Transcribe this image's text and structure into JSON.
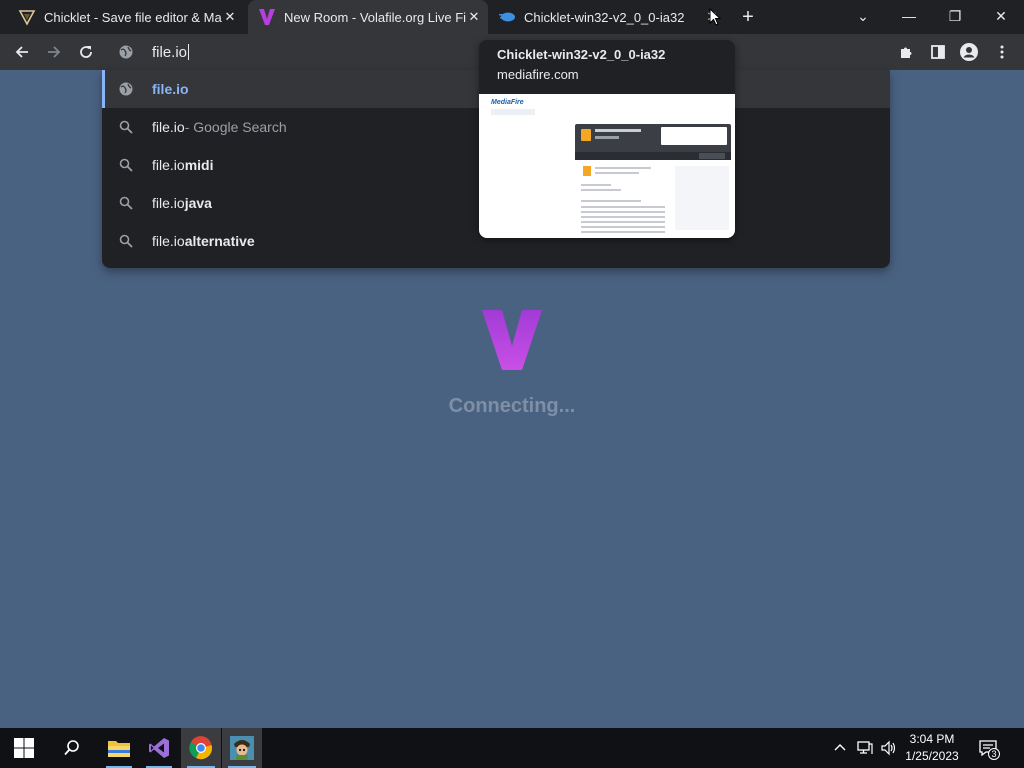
{
  "tabs": [
    {
      "title": "Chicklet - Save file editor & Map",
      "icon": "chicklet-icon",
      "close": "✕"
    },
    {
      "title": "New Room - Volafile.org Live File",
      "icon": "volafile-v-icon",
      "close": "✕"
    },
    {
      "title": "Chicklet-win32-v2_0_0-ia32",
      "icon": "mediafire-icon",
      "close": "✕"
    }
  ],
  "window_controls": {
    "tab_search": "⌄",
    "minimize": "—",
    "restore": "❐",
    "close": "✕"
  },
  "omnibox": {
    "value": "file.io"
  },
  "suggestions": [
    {
      "icon": "globe-icon",
      "main": "file.io",
      "suffix": ""
    },
    {
      "icon": "search-icon",
      "main": "file.io",
      "suffix": " - Google Search"
    },
    {
      "icon": "search-icon",
      "main": "file.io",
      "suffix": " midi"
    },
    {
      "icon": "search-icon",
      "main": "file.io",
      "suffix": " java"
    },
    {
      "icon": "search-icon",
      "main": "file.io",
      "suffix": " alternative"
    }
  ],
  "hovercard": {
    "title": "Chicklet-win32-v2_0_0-ia32",
    "domain": "mediafire.com",
    "thumbnail_logo": "MediaFire"
  },
  "page": {
    "status": "Connecting...",
    "accent_color": "#b93ee0",
    "background_color": "#4a6282"
  },
  "taskbar": {
    "time": "3:04 PM",
    "date": "1/25/2023",
    "notification_count": "3",
    "apps": [
      "file-explorer-icon",
      "visual-studio-icon",
      "chrome-icon",
      "game-app-icon"
    ]
  }
}
